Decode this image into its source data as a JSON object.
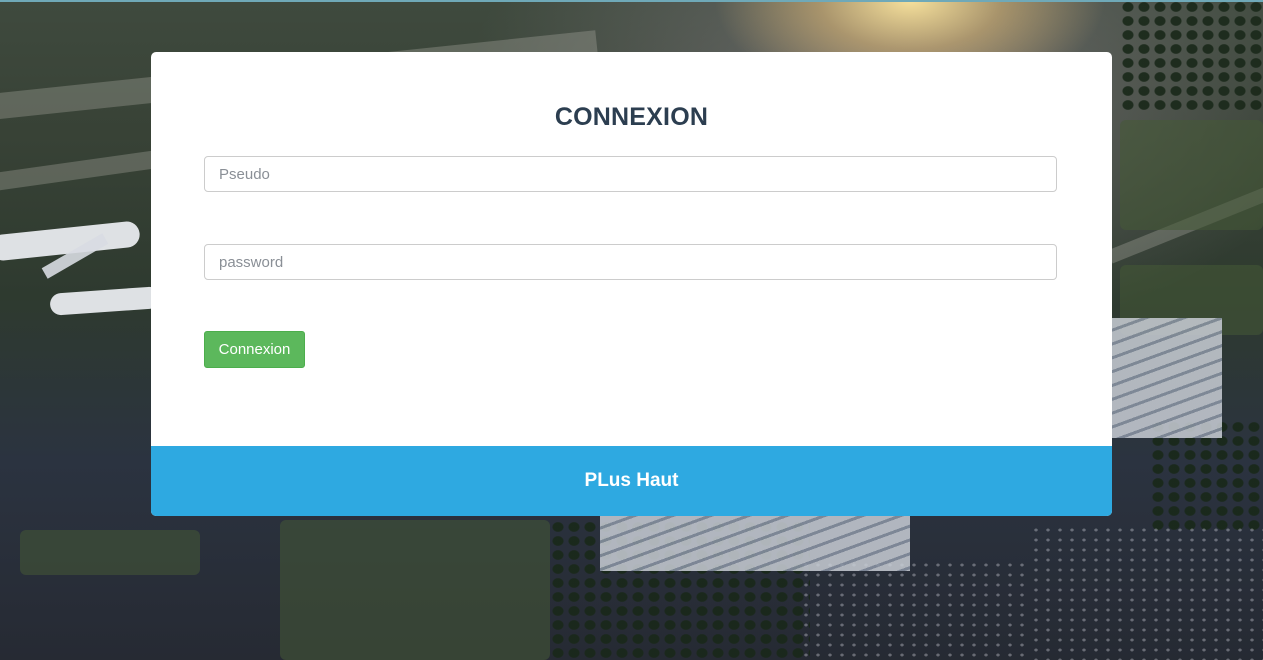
{
  "login": {
    "title": "CONNEXION",
    "username_placeholder": "Pseudo",
    "password_placeholder": "password",
    "submit_label": "Connexion"
  },
  "footer": {
    "link_label": "PLus Haut"
  },
  "colors": {
    "title": "#2c3e50",
    "button": "#5cb85c",
    "footer_bar": "#2ea9e1"
  }
}
